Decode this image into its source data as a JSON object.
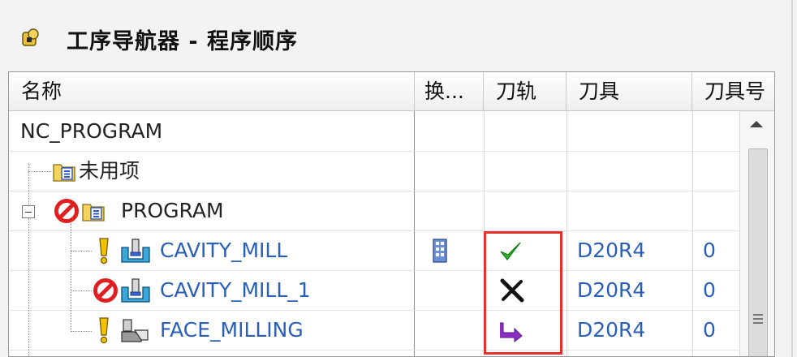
{
  "panel": {
    "title": "工序导航器 - 程序顺序",
    "title_icon": "navigator-icon"
  },
  "columns": [
    {
      "label": "名称"
    },
    {
      "label": "换..."
    },
    {
      "label": "刀轨"
    },
    {
      "label": "刀具"
    },
    {
      "label": "刀具号"
    }
  ],
  "rows": [
    {
      "name": "NC_PROGRAM",
      "status_icon": "",
      "type_icon": "",
      "tool": "",
      "tool_no": ""
    },
    {
      "name": "未用项",
      "status_icon": "",
      "type_icon": "folder-group-icon",
      "tool": "",
      "tool_no": ""
    },
    {
      "name": "PROGRAM",
      "status_icon": "prohibited-icon",
      "type_icon": "folder-group-icon",
      "tool": "",
      "tool_no": ""
    },
    {
      "name": "CAVITY_MILL",
      "status_icon": "warning-exclamation-icon",
      "type_icon": "cavity-mill-icon",
      "change_icon": "tool-change-icon",
      "toolpath_icon": "checkmark-icon",
      "tool": "D20R4",
      "tool_no": "0"
    },
    {
      "name": "CAVITY_MILL_1",
      "status_icon": "prohibited-icon",
      "type_icon": "cavity-mill-icon",
      "toolpath_icon": "x-mark-icon",
      "tool": "D20R4",
      "tool_no": "0"
    },
    {
      "name": "FACE_MILLING",
      "status_icon": "warning-exclamation-icon",
      "type_icon": "face-milling-icon",
      "toolpath_icon": "regenerate-arrow-icon",
      "tool": "D20R4",
      "tool_no": "0"
    }
  ],
  "colors": {
    "operation_text": "#2a5fb8",
    "highlight_box": "#e8302c",
    "check_green": "#2fb52f",
    "arrow_purple": "#8a2fc2",
    "prohibited_red": "#e02020",
    "warning_yellow": "#f2c200"
  }
}
